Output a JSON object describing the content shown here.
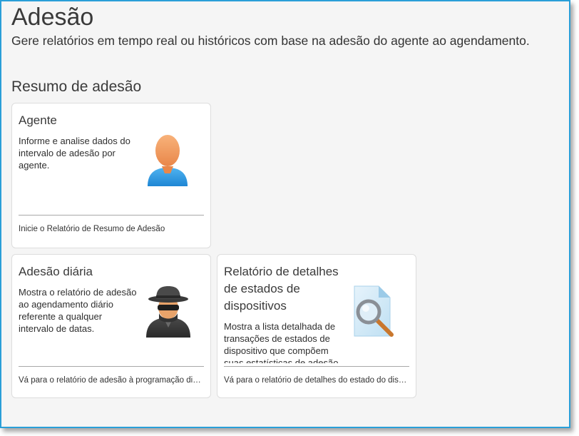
{
  "header": {
    "title": "Adesão",
    "subtitle": "Gere relatórios em tempo real ou históricos com base na adesão do agente ao agendamento."
  },
  "section": {
    "title": "Resumo de adesão"
  },
  "cards": [
    {
      "title": "Agente",
      "description": "Informe e analise dados do intervalo de adesão por agente.",
      "link": "Inicie o Relatório de Resumo de Adesão",
      "icon": "agent-user-icon"
    },
    {
      "title": "Adesão diária",
      "description": "Mostra o relatório de adesão ao agendamento diário referente a qualquer intervalo de datas.",
      "link": "Vá para o relatório de adesão à programação diária",
      "icon": "spy-agent-icon"
    },
    {
      "title": "Relatório de detalhes de estados de dispositivos",
      "description": "Mostra a lista detalhada de transações de estados de dispositivo que compõem suas estatísticas de adesão.",
      "link": "Vá para o relatório de detalhes do estado do dispositivo",
      "icon": "document-search-icon"
    }
  ],
  "colors": {
    "frame_border": "#2a9fd8",
    "background": "#f5f5f5",
    "card_background": "#ffffff"
  }
}
